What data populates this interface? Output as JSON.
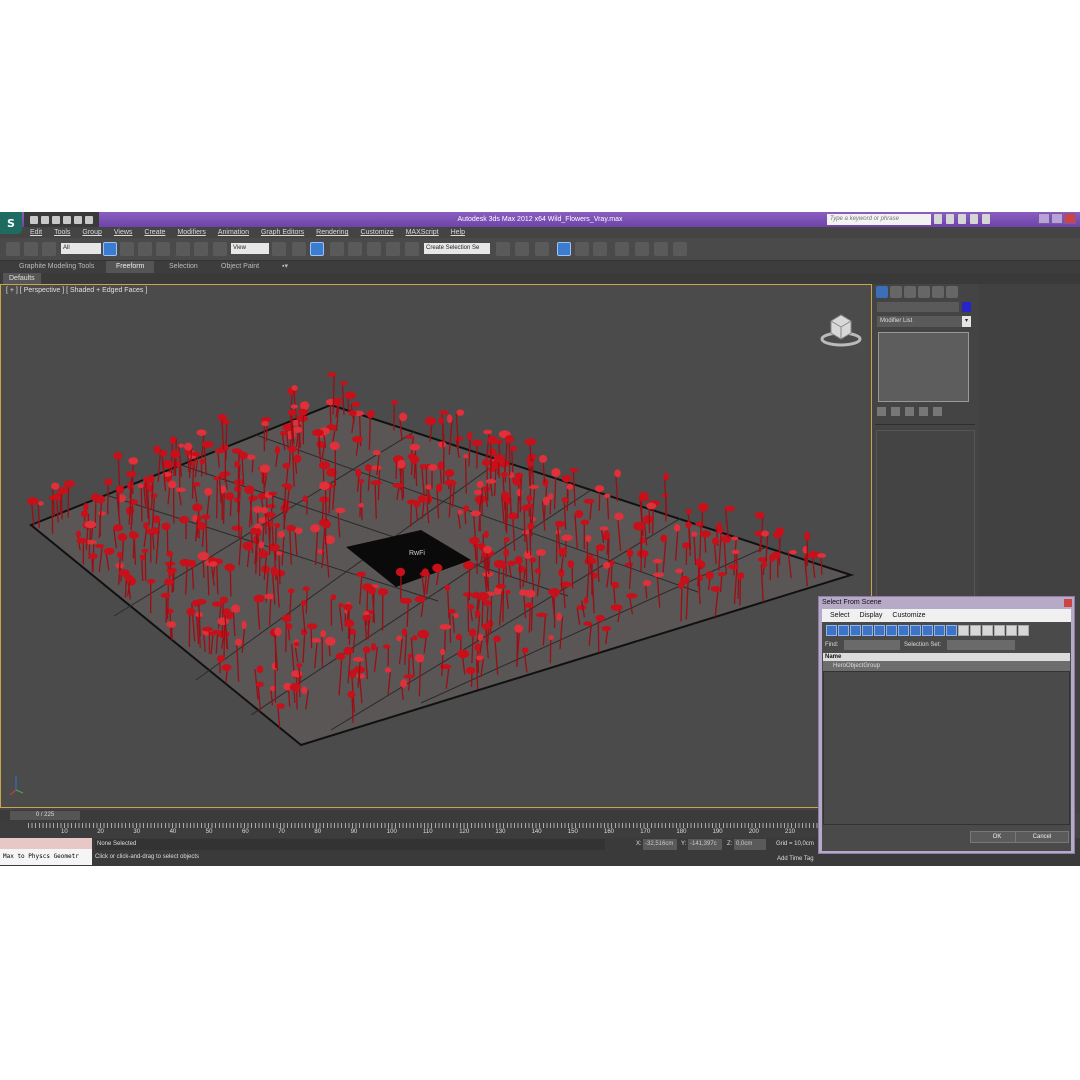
{
  "window": {
    "title": "Autodesk 3ds Max  2012 x64     Wild_Flowers_Vray.max",
    "search_placeholder": "Type a keyword or phrase"
  },
  "menu": [
    "Edit",
    "Tools",
    "Group",
    "Views",
    "Create",
    "Modifiers",
    "Animation",
    "Graph Editors",
    "Rendering",
    "Customize",
    "MAXScript",
    "Help"
  ],
  "toolbar": {
    "filter_value": "All",
    "refcoord_value": "View",
    "selection_set_value": "Create Selection Se"
  },
  "ribbon": {
    "tabs": [
      "Graphite Modeling Tools",
      "Freeform",
      "Selection",
      "Object Paint"
    ],
    "active_tab": "Freeform",
    "defaults_label": "Defaults"
  },
  "viewport": {
    "label": "[ + ] [ Perspective ] [ Shaded + Edged Faces ]",
    "center_label": "RwFi"
  },
  "command_panel": {
    "modifier_list": "Modifier List",
    "color": "#2626c8"
  },
  "timeline": {
    "frame_display": "0 / 225",
    "ticks": [
      "10",
      "20",
      "30",
      "40",
      "50",
      "60",
      "70",
      "80",
      "90",
      "100",
      "110",
      "120",
      "130",
      "140",
      "150",
      "160",
      "170",
      "180",
      "190",
      "200",
      "210"
    ]
  },
  "status": {
    "maxscript": "Max to Physcs Geometr",
    "selection": "None Selected",
    "prompt": "Click or click-and-drag to select objects",
    "x_label": "X:",
    "x_value": "-32,516cm",
    "y_label": "Y:",
    "y_value": "-141,397c",
    "z_label": "Z:",
    "z_value": "0,0cm",
    "grid": "Grid = 10,0cm",
    "add_time_tag": "Add Time Tag"
  },
  "dialog": {
    "title": "Select From Scene",
    "menu": [
      "Select",
      "Display",
      "Customize"
    ],
    "find_label": "Find:",
    "selection_set_label": "Selection Set:",
    "column_name": "Name",
    "rows": [
      "HeroObjectGroup"
    ],
    "ok": "OK",
    "cancel": "Cancel"
  },
  "accent_colors": {
    "title": "#7a4fb3",
    "flowers": "#c8101a",
    "active": "#3b7bd0"
  }
}
